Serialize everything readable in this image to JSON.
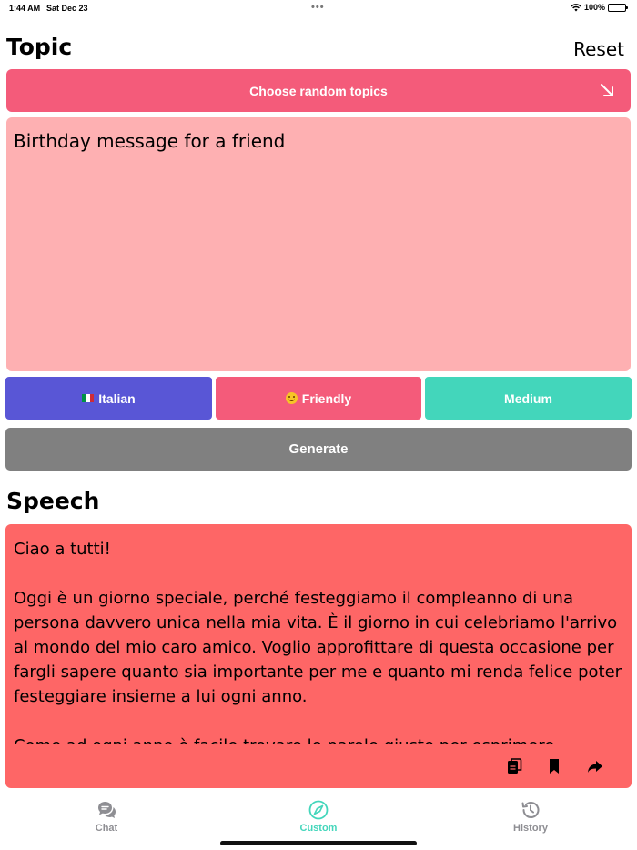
{
  "status_bar": {
    "time": "1:44 AM",
    "date": "Sat Dec 23",
    "battery": "100%"
  },
  "topic": {
    "title": "Topic",
    "reset_label": "Reset",
    "random_button": "Choose random topics",
    "input_value": "Birthday message for a friend"
  },
  "options": {
    "language": "Italian",
    "tone": "Friendly",
    "length": "Medium"
  },
  "generate_label": "Generate",
  "speech": {
    "title": "Speech",
    "paragraphs": [
      "Ciao a tutti!",
      "Oggi è un giorno speciale, perché festeggiamo il compleanno di una persona davvero unica nella mia vita. È il giorno in cui celebriamo l'arrivo al mondo del mio caro amico. Voglio approfittare di questa occasione per fargli sapere quanto sia importante per me e quanto mi renda felice poter festeggiare insieme a lui ogni anno.",
      "Come ad ogni anno è facile trovare le parole giuste per esprimere"
    ]
  },
  "tabs": [
    {
      "label": "Chat",
      "icon": "chat-bubbles-icon"
    },
    {
      "label": "Custom",
      "icon": "compass-icon"
    },
    {
      "label": "History",
      "icon": "history-clock-icon"
    }
  ],
  "colors": {
    "random_button": "#f45b7a",
    "topic_box": "#feb0b2",
    "language": "#5956d6",
    "tone": "#f45b7a",
    "length": "#43d6bb",
    "generate": "#808080",
    "speech_box": "#fe6666",
    "active_tab": "#43d6bb"
  }
}
